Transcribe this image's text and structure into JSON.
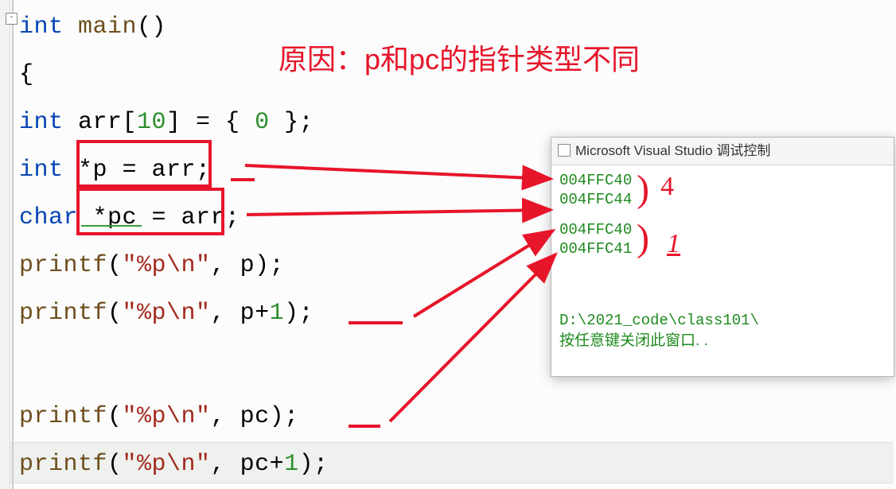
{
  "editor": {
    "fold_symbol": "-",
    "lines": {
      "l1_pre": "int ",
      "l1_fn": "main",
      "l1_post": "()",
      "l2": "{",
      "l3_pre": "    int ",
      "l3_mid": "arr[",
      "l3_num1": "10",
      "l3_mid2": "] = { ",
      "l3_num2": "0",
      "l3_post": " };",
      "l4_pre": "    int  ",
      "l4_post": "*p = arr;",
      "l5_pre": "    char ",
      "l5_post": "*pc = arr;",
      "l6a": "    ",
      "l6fn": "printf",
      "l6b": "(",
      "l6s": "\"%p\\n\"",
      "l6c": ", p);",
      "l7a": "    ",
      "l7fn": "printf",
      "l7b": "(",
      "l7s": "\"%p\\n\"",
      "l7c": ", p+",
      "l7n": "1",
      "l7d": ");",
      "l9a": "    ",
      "l9fn": "printf",
      "l9b": "(",
      "l9s": "\"%p\\n\"",
      "l9c": ", pc);",
      "l10a": "    ",
      "l10fn": "printf",
      "l10b": "(",
      "l10s": "\"%p\\n\"",
      "l10c": ", pc+",
      "l10n": "1",
      "l10d": ");"
    }
  },
  "annotation": {
    "reason": "原因：p和pc的指针类型不同",
    "diff1": "4",
    "diff2": "1"
  },
  "console": {
    "title": "Microsoft Visual Studio 调试控制",
    "out1": "004FFC40",
    "out2": "004FFC44",
    "out3": "004FFC40",
    "out4": "004FFC41",
    "path": "D:\\2021_code\\class101\\",
    "prompt_cn": "按任意键关闭此窗口. . "
  },
  "colors": {
    "keyword": "#0645b4",
    "function": "#6f4e1e",
    "string": "#a22a1e",
    "number": "#2c8f2c",
    "annotation": "#e7152a",
    "console_out": "#1e8a1e"
  }
}
